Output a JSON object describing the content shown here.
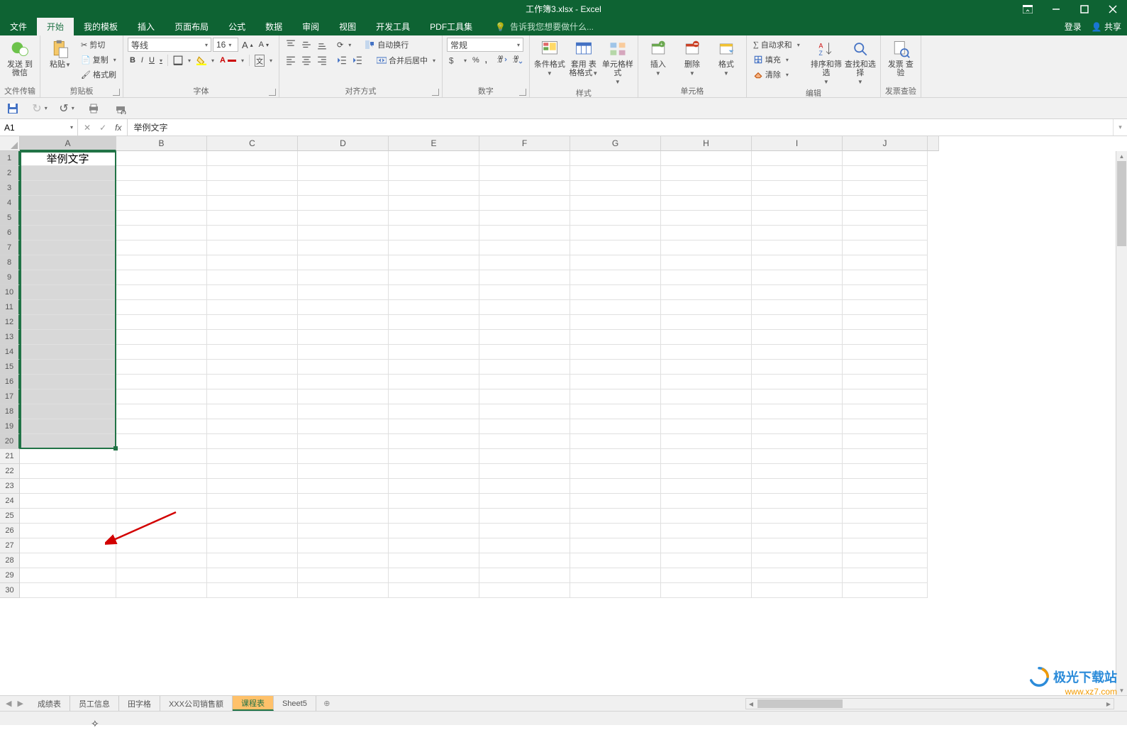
{
  "title": "工作簿3.xlsx - Excel",
  "rightTop": {
    "login": "登录",
    "share": "共享"
  },
  "tabs": [
    "文件",
    "开始",
    "我的模板",
    "插入",
    "页面布局",
    "公式",
    "数据",
    "审阅",
    "视图",
    "开发工具",
    "PDF工具集"
  ],
  "activeTab": 1,
  "tellMe": "告诉我您想要做什么...",
  "ribbon": {
    "g1": {
      "label": "文件传输",
      "btn": "发送\n到微信"
    },
    "g2": {
      "label": "剪贴板",
      "paste": "粘贴",
      "cut": "剪切",
      "copy": "复制",
      "brush": "格式刷"
    },
    "g3": {
      "label": "字体",
      "fontName": "等线",
      "fontSize": "16",
      "bold": "B",
      "italic": "I",
      "underline": "U",
      "incA": "A",
      "decA": "A",
      "wen": "文"
    },
    "g4": {
      "label": "对齐方式",
      "wrap": "自动换行",
      "merge": "合并后居中"
    },
    "g5": {
      "label": "数字",
      "format": "常规"
    },
    "g6": {
      "label": "样式",
      "cond": "条件格式",
      "table": "套用\n表格格式",
      "cellStyle": "单元格样式"
    },
    "g7": {
      "label": "单元格",
      "insert": "插入",
      "delete": "删除",
      "format": "格式"
    },
    "g8": {
      "label": "编辑",
      "sum": "自动求和",
      "fill": "填充",
      "clear": "清除",
      "sort": "排序和筛选",
      "find": "查找和选择"
    },
    "g9": {
      "label": "发票查验",
      "btn": "发票\n查验"
    }
  },
  "nameBox": "A1",
  "formula": "举例文字",
  "columns": [
    "A",
    "B",
    "C",
    "D",
    "E",
    "F",
    "G",
    "H",
    "I",
    "J"
  ],
  "rows": [
    1,
    2,
    3,
    4,
    5,
    6,
    7,
    8,
    9,
    10,
    11,
    12,
    13,
    14,
    15,
    16,
    17,
    18,
    19,
    20,
    21,
    22,
    23,
    24,
    25,
    26,
    27,
    28,
    29,
    30
  ],
  "cellA1": "举例文字",
  "sheets": [
    "成绩表",
    "员工信息",
    "田字格",
    "XXX公司销售额",
    "课程表",
    "Sheet5"
  ],
  "activeSheet": 4,
  "watermark": {
    "brand": "极光下载站",
    "url": "www.xz7.com"
  }
}
